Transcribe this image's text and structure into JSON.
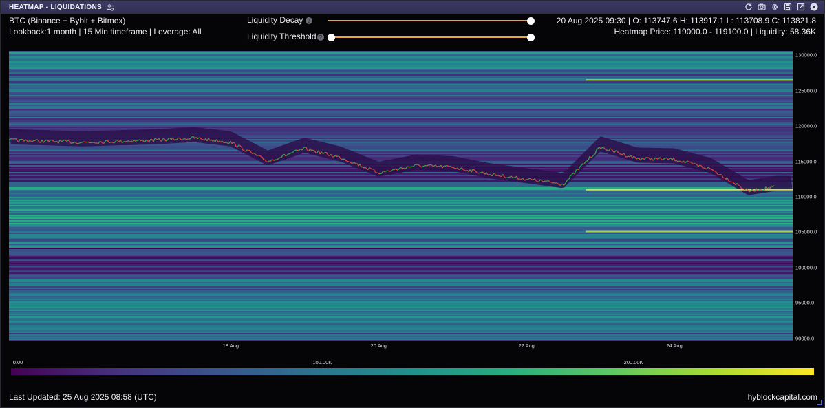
{
  "window": {
    "title": "HEATMAP - LIQUIDATIONS",
    "icons": [
      "refresh-icon",
      "camera-icon",
      "gear-icon",
      "save-icon",
      "expand-icon",
      "close-icon"
    ]
  },
  "header": {
    "market": "BTC (Binance + Bybit + Bitmex)",
    "settings": "Lookback:1 month | 15 Min timeframe | Leverage: All",
    "ohlc": "20 Aug 2025 09:30 | O: 113747.6 H: 113917.1 L: 113708.9 C: 113821.8",
    "hover": "Heatmap Price: 119000.0 - 119100.0 | Liquidity: 58.36K"
  },
  "controls": {
    "decay_label": "Liquidity Decay",
    "decay_value": 1.0,
    "threshold_label": "Liquidity Threshold",
    "threshold_low": 0.0,
    "threshold_high": 1.0,
    "help_glyph": "?"
  },
  "colors": {
    "track": "#e8a73a",
    "candle_up": "#2ea84a",
    "candle_down": "#e0443a",
    "scale_low": "#440154",
    "scale_high": "#fde725"
  },
  "chart_data": {
    "type": "heatmap",
    "y_axis": {
      "ticks": [
        "130000.0",
        "125000.0",
        "120000.0",
        "115000.0",
        "110000.0",
        "105000.0",
        "100000.0",
        "95000.0",
        "90000.0"
      ],
      "range": [
        89600,
        130600
      ]
    },
    "x_axis": {
      "ticks": [
        "18 Aug",
        "20 Aug",
        "22 Aug",
        "24 Aug"
      ]
    },
    "color_scale": {
      "labels": [
        "0.00",
        "100.00K",
        "200.00K"
      ],
      "min": 0,
      "max": 258000
    },
    "price_series": {
      "x": [
        "15 Aug",
        "16 Aug",
        "17 Aug",
        "17 Aug 12:00",
        "18 Aug",
        "18 Aug 12:00",
        "19 Aug",
        "19 Aug 12:00",
        "20 Aug",
        "20 Aug 12:00",
        "21 Aug",
        "21 Aug 12:00",
        "22 Aug",
        "22 Aug 12:00",
        "23 Aug",
        "23 Aug 12:00",
        "24 Aug",
        "24 Aug 12:00",
        "25 Aug",
        "25 Aug 08:45"
      ],
      "close": [
        118000,
        117700,
        118000,
        118300,
        117700,
        115000,
        116800,
        115500,
        113400,
        114400,
        114200,
        113200,
        112500,
        111800,
        117000,
        115400,
        115300,
        113900,
        110800,
        111400
      ]
    },
    "bright_levels": [
      126500,
      111000,
      105100
    ]
  },
  "footer": {
    "updated": "Last Updated: 25 Aug 2025 08:58 (UTC)",
    "brand": "hyblockcapital.com"
  }
}
